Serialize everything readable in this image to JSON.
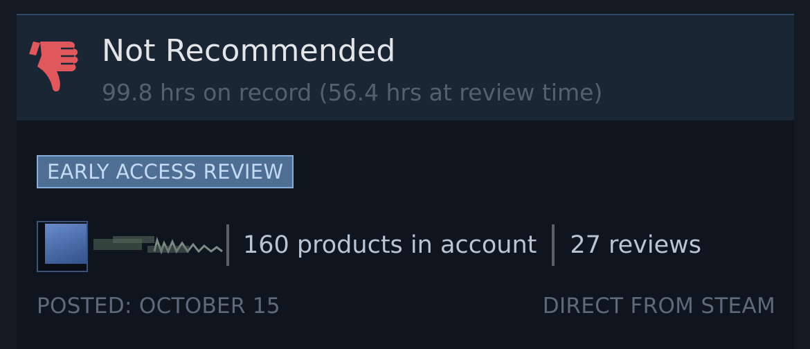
{
  "review": {
    "verdict": "Not Recommended",
    "hours": "99.8 hrs on record (56.4 hrs at review time)",
    "badge": "EARLY ACCESS REVIEW",
    "author": {
      "products": "160 products in account",
      "reviews": "27 reviews"
    },
    "posted": "POSTED: OCTOBER 15",
    "source": "DIRECT FROM STEAM"
  },
  "colors": {
    "thumb_down": "#e0585b",
    "badge_bg": "#4f6e93",
    "badge_border": "#86aedb"
  },
  "icons": {
    "verdict": "thumbs-down-icon"
  }
}
